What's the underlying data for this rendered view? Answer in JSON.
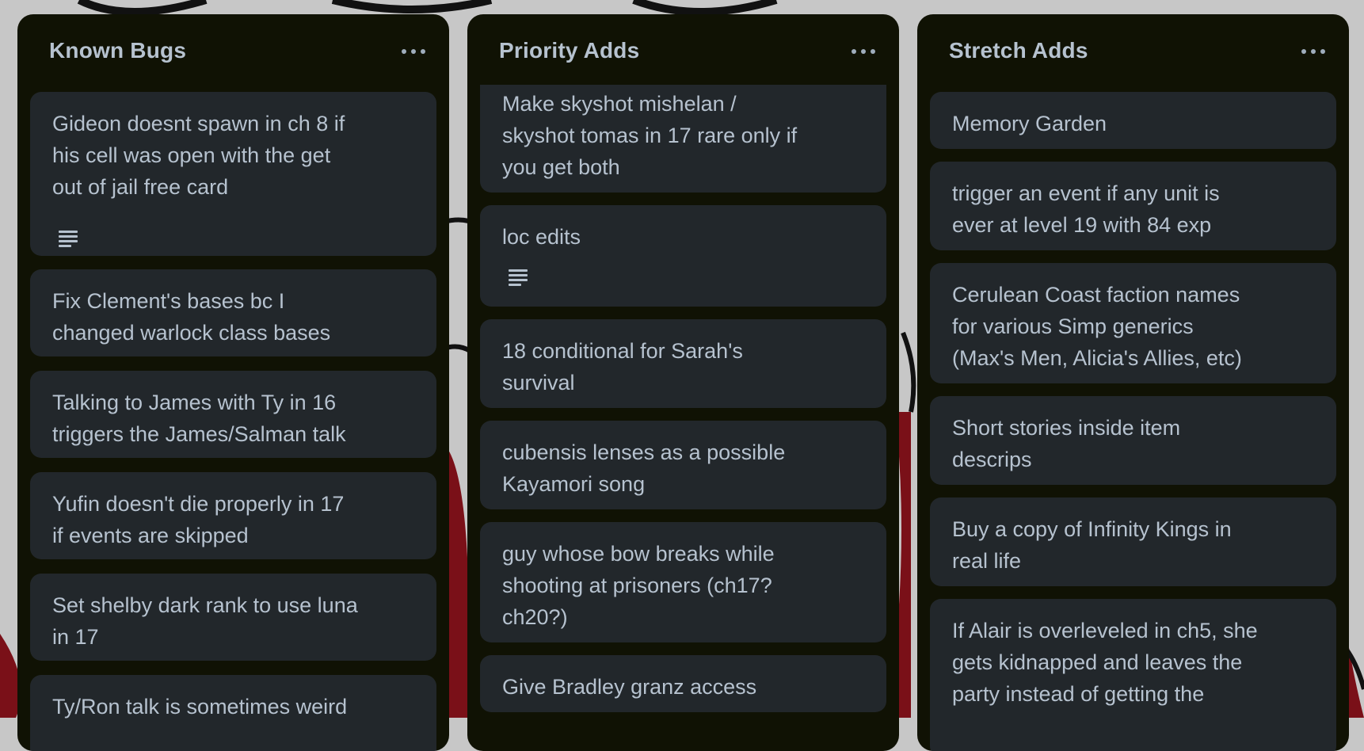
{
  "lists": [
    {
      "title": "Known Bugs",
      "cards": [
        {
          "text": "Gideon doesnt spawn in ch 8 if\nhis cell was open with the get\nout of jail free card",
          "has_description": true
        },
        {
          "text": "Fix Clement's bases bc I\nchanged warlock class bases",
          "has_description": false
        },
        {
          "text": "Talking to James with Ty in 16\ntriggers the James/Salman talk",
          "has_description": false
        },
        {
          "text": "Yufin doesn't die properly in 17\nif events are skipped",
          "has_description": false
        },
        {
          "text": "Set shelby dark rank to use luna\nin 17",
          "has_description": false
        },
        {
          "text": "Ty/Ron talk is sometimes weird",
          "has_description": false
        }
      ]
    },
    {
      "title": "Priority Adds",
      "cards": [
        {
          "text": "Make skyshot mishelan /\nskyshot tomas in 17 rare only if\nyou get both",
          "has_description": false
        },
        {
          "text": "loc edits",
          "has_description": true
        },
        {
          "text": "18 conditional for Sarah's\nsurvival",
          "has_description": false
        },
        {
          "text": "cubensis lenses as a possible\nKayamori song",
          "has_description": false
        },
        {
          "text": "guy whose bow breaks while\nshooting at prisoners (ch17?\nch20?)",
          "has_description": false
        },
        {
          "text": "Give Bradley granz access",
          "has_description": false
        }
      ]
    },
    {
      "title": "Stretch Adds",
      "cards": [
        {
          "text": "Memory Garden",
          "has_description": false
        },
        {
          "text": "trigger an event if any unit is\never at level 19 with 84 exp",
          "has_description": false
        },
        {
          "text": "Cerulean Coast faction names\nfor various Simp generics\n(Max's Men, Alicia's Allies, etc)",
          "has_description": false
        },
        {
          "text": "Short stories inside item\ndescrips",
          "has_description": false
        },
        {
          "text": "Buy a copy of Infinity Kings in\nreal life",
          "has_description": false
        },
        {
          "text": "If Alair is overleveled in ch5, she\ngets kidnapped and leaves the\nparty instead of getting the",
          "has_description": false
        }
      ]
    }
  ],
  "icons": {
    "list_menu": "more-horizontal-icon",
    "card_description": "description-lines-icon"
  },
  "colors": {
    "list_background": "#101204",
    "card_background": "#22272b",
    "text": "#b6c2cf",
    "board_background": "#c7c7c7"
  }
}
